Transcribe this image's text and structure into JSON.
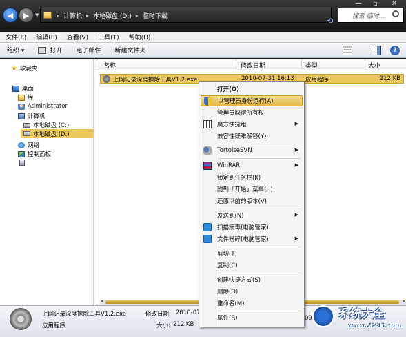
{
  "address": {
    "crumbs": [
      "计算机",
      "本地磁盘 (D:)",
      "临时下载"
    ],
    "search_placeholder": "搜索 临时..."
  },
  "menubar": [
    "文件(F)",
    "编辑(E)",
    "查看(V)",
    "工具(T)",
    "帮助(H)"
  ],
  "toolbar": {
    "organize": "组织 ▾",
    "print": "打开",
    "email": "电子邮件",
    "new_folder": "新建文件夹"
  },
  "nav": {
    "favorites": "收藏夹",
    "desktop": "桌面",
    "library": "库",
    "admin": "Administrator",
    "computer": "计算机",
    "disk_c": "本地磁盘 (C:)",
    "disk_d": "本地磁盘 (D:)",
    "network": "网络",
    "control_panel": "控制面板"
  },
  "columns": {
    "name": "名称",
    "date": "修改日期",
    "type": "类型",
    "size": "大小"
  },
  "file": {
    "name": "上网记录深度擦除工具V1.2.exe",
    "date": "2010-07-31 16:13",
    "type": "应用程序",
    "size": "212 KB"
  },
  "context_menu": {
    "open": "打开(O)",
    "run_as_admin": "以管理员身份运行(A)",
    "take_ownership": "管理员取得所有权",
    "magic_shortcut": "魔方快捷组",
    "compat": "兼容性疑难解答(Y)",
    "tortoise": "TortoiseSVN",
    "winrar": "WinRAR",
    "pin_taskbar": "锁定到任务栏(K)",
    "pin_start": "附到「开始」菜单(U)",
    "restore": "还原以前的版本(V)",
    "send_to": "发送到(N)",
    "scan": "扫描病毒(电脑管家)",
    "shred": "文件粉碎(电脑管家)",
    "cut": "剪切(T)",
    "copy": "复制(C)",
    "create_shortcut": "创建快捷方式(S)",
    "delete": "删除(D)",
    "rename": "重命名(M)",
    "properties": "属性(R)"
  },
  "details": {
    "name": "上网记录深度擦除工具V1.2.exe",
    "date_label": "修改日期:",
    "date_value": "2010-07-",
    "type": "应用程序",
    "size_label": "大小:",
    "size_value": "212 KB",
    "extra": "09"
  },
  "watermark": {
    "title": "系统大全",
    "url": "www.XP85.com"
  }
}
